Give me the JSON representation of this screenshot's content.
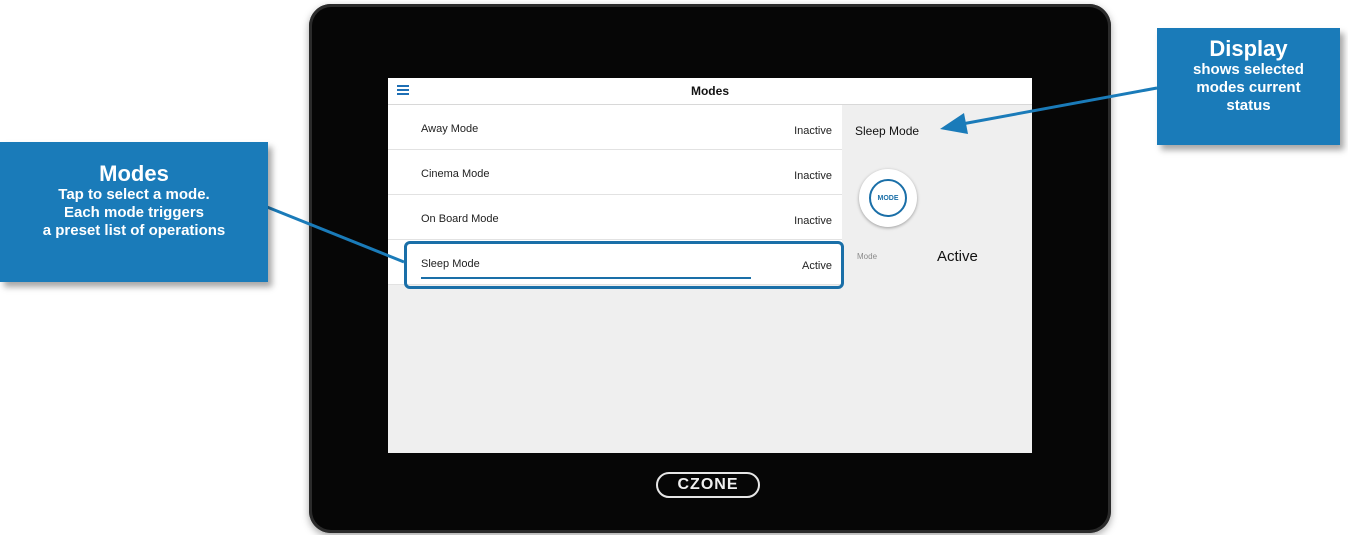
{
  "screen": {
    "title": "Modes",
    "modes": [
      {
        "name": "Away Mode",
        "status": "Inactive",
        "selected": false
      },
      {
        "name": "Cinema Mode",
        "status": "Inactive",
        "selected": false
      },
      {
        "name": "On Board Mode",
        "status": "Inactive",
        "selected": false
      },
      {
        "name": "Sleep Mode",
        "status": "Active",
        "selected": true
      }
    ],
    "detail": {
      "title": "Sleep  Mode",
      "button_label": "MODE",
      "status_label": "Mode",
      "status_value": "Active"
    }
  },
  "brand": {
    "logo_text": "CZONE"
  },
  "callouts": {
    "modes": {
      "title": "Modes",
      "lines": [
        "Tap to select a mode.",
        "Each mode triggers",
        "a preset list of operations"
      ]
    },
    "display": {
      "title": "Display",
      "lines": [
        "shows selected",
        "modes current",
        "status"
      ]
    }
  },
  "colors": {
    "accent": "#1a7bb9",
    "highlight": "#1a6fa8",
    "bezel": "#060606"
  },
  "icons": {
    "menu": "hamburger-icon"
  }
}
